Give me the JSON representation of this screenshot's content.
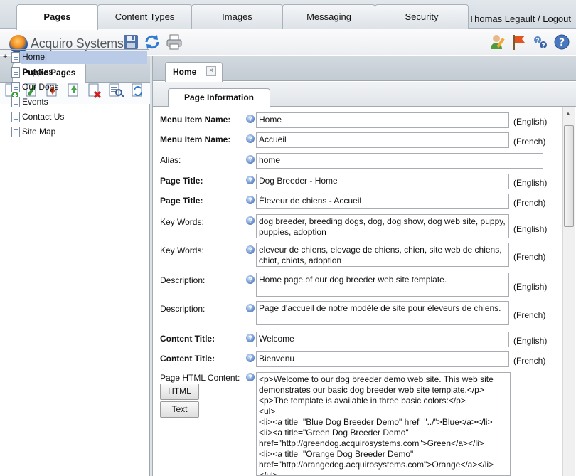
{
  "top_tabs": [
    {
      "label": "Pages",
      "active": true
    },
    {
      "label": "Content Types",
      "active": false
    },
    {
      "label": "Images",
      "active": false
    },
    {
      "label": "Messaging",
      "active": false
    },
    {
      "label": "Security",
      "active": false
    }
  ],
  "user": {
    "link": "Thomas Legault / Logout"
  },
  "brand": {
    "name": "Acquiro Systems"
  },
  "toolbar_icons": [
    "save-icon",
    "refresh-icon",
    "print-icon",
    "user-edit-icon",
    "flag-icon",
    "help-users-icon",
    "help-icon"
  ],
  "left_panel": {
    "tab": "Public Pages",
    "toolbar_icons": [
      "add-page-icon",
      "edit-page-icon",
      "move-down-icon",
      "move-up-icon",
      "delete-page-icon",
      "properties-icon",
      "preview-icon",
      "refresh-icon"
    ],
    "tree": [
      {
        "label": "Home",
        "selected": true,
        "expandable": true
      },
      {
        "label": "Puppies"
      },
      {
        "label": "Our Dogs"
      },
      {
        "label": "Events"
      },
      {
        "label": "Contact Us"
      },
      {
        "label": "Site Map"
      }
    ]
  },
  "document": {
    "tab": "Home",
    "close": "×",
    "section_tab": "Page Information"
  },
  "form": {
    "rows": [
      {
        "label": "Menu Item Name:",
        "value": "Home",
        "lang": "(English)"
      },
      {
        "label": "Menu Item Name:",
        "value": "Accueil",
        "lang": "(French)"
      },
      {
        "label": "Alias:",
        "value": "home",
        "lang": ""
      },
      {
        "label": "Page Title:",
        "value": "Dog Breeder - Home",
        "lang": "(English)"
      },
      {
        "label": "Page Title:",
        "value": "Éleveur de chiens - Accueil",
        "lang": "(French)"
      },
      {
        "label": "Key Words:",
        "value": "dog breeder, breeding dogs, dog, dog show, dog web site, puppy, puppies, adoption",
        "lang": "(English)"
      },
      {
        "label": "Key Words:",
        "value": "eleveur de chiens, elevage de chiens, chien, site web de chiens, chiot, chiots, adoption",
        "lang": "(French)"
      },
      {
        "label": "Description:",
        "value": "Home page of our dog breeder web site template.",
        "lang": "(English)"
      },
      {
        "label": "Description:",
        "value": "Page d'accueil de notre modèle de site pour éleveurs de chiens.",
        "lang": "(French)"
      },
      {
        "label": "Content Title:",
        "value": "Welcome",
        "lang": "(English)"
      },
      {
        "label": "Content Title:",
        "value": "Bienvenu",
        "lang": "(French)"
      }
    ],
    "html_content_label": "Page HTML Content:",
    "html_button": "HTML",
    "text_button": "Text",
    "html_content": "<p>Welcome to our dog breeder demo web site. This web site demonstrates our basic dog breeder web site template.</p>\n<p>The template is available in three basic colors:</p>\n<ul>\n<li><a title=\"Blue Dog Breeder Demo\" href=\"../\">Blue</a></li>\n<li><a title=\"Green Dog Breeder Demo\"\nhref=\"http://greendog.acquirosystems.com\">Green</a></li>\n<li><a title=\"Orange Dog Breeder Demo\"\nhref=\"http://orangedog.acquirosystems.com\">Orange</a></li>\n</ul>"
  },
  "colors": {
    "selection": "#b4c7e7",
    "help_icon": "#5b86c7",
    "tab_bar": "#d3dae1"
  }
}
